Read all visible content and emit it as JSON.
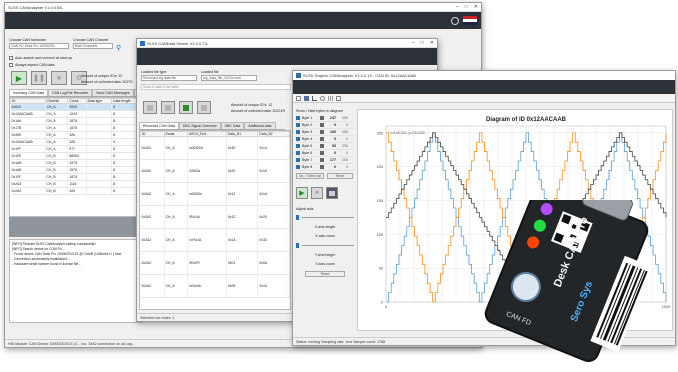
{
  "win1": {
    "title": "SLSS CANAnalyser V1.0.0.B/L",
    "choose_hardware_label": "Choose CAN hardware",
    "hardware_value": "CAN FD Desk Pro 100002S1",
    "choose_channel_label": "Choose CAN Channel",
    "channel_value": "Both Channels",
    "auto_connect": "Auto-search and connect at start-up",
    "always_expect": "Always expect CAN data",
    "unique_ids_label": "Amount of unique ID's: 12",
    "collected_label": "Amount of collected data: 30270",
    "tabs": [
      "Incoming CAN Data",
      "CAN Log/File Recorder",
      "Send CAN Messages",
      "Standalone"
    ],
    "columns": [
      "ID",
      "Channel",
      "Count",
      "Data type",
      "Data length"
    ],
    "rows": [
      [
        "0x010",
        "CH_A",
        "2000",
        "",
        "8"
      ],
      [
        "0x12AACAAB",
        "CH_A",
        "1243",
        "",
        "8"
      ],
      [
        "0x16A",
        "CH_A",
        "1878",
        "",
        "8"
      ],
      [
        "0x17B",
        "CH_A",
        "1878",
        "",
        "8"
      ],
      [
        "0x355",
        "CH_A",
        "326",
        "",
        "8"
      ],
      [
        "0x12AACAAB",
        "CH_A",
        "326",
        "",
        "8"
      ],
      [
        "0x1FF",
        "CH_A",
        "977",
        "",
        "8"
      ],
      [
        "0x1FE",
        "CH_B",
        "68083",
        "",
        "8"
      ],
      [
        "0x1AB",
        "CH_B",
        "1575",
        "",
        "8"
      ],
      [
        "0x1AB",
        "CH_B",
        "1575",
        "",
        "8"
      ],
      [
        "0x1FF",
        "CH_B",
        "1878",
        "",
        "8"
      ],
      [
        "0x2A3",
        "CH_B",
        "1116",
        "",
        "8"
      ],
      [
        "0x2A2",
        "CH_B",
        "326",
        "",
        "8"
      ]
    ],
    "log_lines": [
      "[INFO] Finished SLSS CANAnalyser startup successfully!",
      "[INFO] Search device on COM Po...",
      "- Found device CAN Desk Pro 100002S1S1S @ ChA/B (100kbit/s+1 ) Mod",
      "- Connection successfully established...",
      "- Hardware serial number found in license file..."
    ],
    "status": "HW-Module: CAN Device 100002S1S1S (C... Inc. 10A2    connection ok ok    Log..."
  },
  "win2": {
    "title": "SLSS CANData Viewer V1.0.0.T/L",
    "loaded_file_type_label": "Loaded file type",
    "loaded_file_type_value": "Recorded log data file",
    "loaded_file_label": "Loaded file",
    "loaded_file_value": "log_data_file_2023x.csdf",
    "search_placeholder": "Search data in the table",
    "unique_ids_label": "Amount of unique ID's: 12",
    "collected_label": "Amount of collected data: 30221R",
    "tabs": [
      "Recorded CAN Data",
      "DBC Signal Overview",
      "DBC Data",
      "Additional data"
    ],
    "columns": [
      "ID",
      "Kanal",
      "ASCII_Text",
      "Data_B1",
      "Data_B2"
    ],
    "rows": [
      [
        "0x2A2",
        "CH_A",
        "\\x00\\00/e",
        "0x1E",
        "0x14"
      ],
      [
        "0x2A2",
        "CH_A",
        "\\00\\00z",
        "0x20",
        "0x15"
      ],
      [
        "0x2A2",
        "CH_A",
        "\\x00\\00e",
        "0x12",
        "0x1A"
      ],
      [
        "0x2A2",
        "CH_A",
        "\\R\\x1A/",
        "0x1C",
        "0x20"
      ],
      [
        "0x2A2",
        "CH_A",
        "\\x7f\\x1A",
        "0x1A",
        "0x33"
      ],
      [
        "0x2A2",
        "CH_A",
        "\\R\\x0F\\",
        "0x01",
        "0x0A"
      ],
      [
        "0x2A2",
        "CH_A",
        "\\x0\\x0A\\",
        "0x0E",
        "0x16"
      ]
    ],
    "status": "Selected row index: 1"
  },
  "win3": {
    "title": "SLSS Graphic CANAnalyser V1.0.0.13 - CAN ID: 0x12AACAAB",
    "show_hide_label": "Show / Hide bytes in diagram",
    "bytes": [
      {
        "name": "Byte 1",
        "value": "247",
        "raw": "255"
      },
      {
        "name": "Byte 2",
        "value": "0",
        "raw": "0"
      },
      {
        "name": "Byte 3",
        "value": "100",
        "raw": "255"
      },
      {
        "name": "Byte 4",
        "value": "0",
        "raw": "0"
      },
      {
        "name": "Byte 5",
        "value": "65",
        "raw": "255"
      },
      {
        "name": "Byte 6",
        "value": "0",
        "raw": "0"
      },
      {
        "name": "Byte 7",
        "value": "177",
        "raw": "255"
      },
      {
        "name": "Byte 8",
        "value": "0",
        "raw": "0"
      }
    ],
    "deselect_all": "De- / Select all",
    "reset": "Reset",
    "adjust_axis": "Adjust axis",
    "x_length": "X-axis length",
    "x_zoom": "X-axis zoom",
    "y_height": "Y-axis height",
    "y_zoom": "Y-axis zoom",
    "reset_axis": "Reset",
    "status": "Status: running    Sampling rate: 1ms    Sample count: 1788"
  },
  "chart_data": {
    "type": "line",
    "title": "Diagram of ID 0x12AACAAB",
    "annotation": "x=145,329; y=234,820",
    "xlim": [
      0,
      1000
    ],
    "ylim": [
      0,
      260
    ],
    "x_ticks": [
      "0",
      "500",
      "1000"
    ],
    "y_ticks": [
      "0",
      "50",
      "100",
      "150",
      "200",
      "250"
    ],
    "legend": [
      "Byte 1",
      "Byte 3",
      "Byte 5"
    ],
    "series": [
      {
        "name": "Byte 1",
        "color": "#5a9fd4",
        "values": [
          0,
          250,
          0,
          250,
          0,
          250,
          0
        ]
      },
      {
        "name": "Byte 3",
        "color": "#ff8c1a",
        "values": [
          250,
          0,
          250,
          0,
          250,
          0,
          250
        ]
      },
      {
        "name": "Byte 5",
        "color": "#444444",
        "values": [
          125,
          250,
          125,
          0,
          125,
          250,
          125
        ]
      }
    ]
  },
  "device": {
    "brand": "Sero Sys",
    "product": "Desk CAN Pro",
    "label_text": "CAN FD",
    "led_colors": [
      "#b54cff",
      "#22dd44",
      "#ff4400"
    ]
  },
  "colors": {
    "accent": "#2a6fb3",
    "chart_grid": "#e4e4e4"
  }
}
